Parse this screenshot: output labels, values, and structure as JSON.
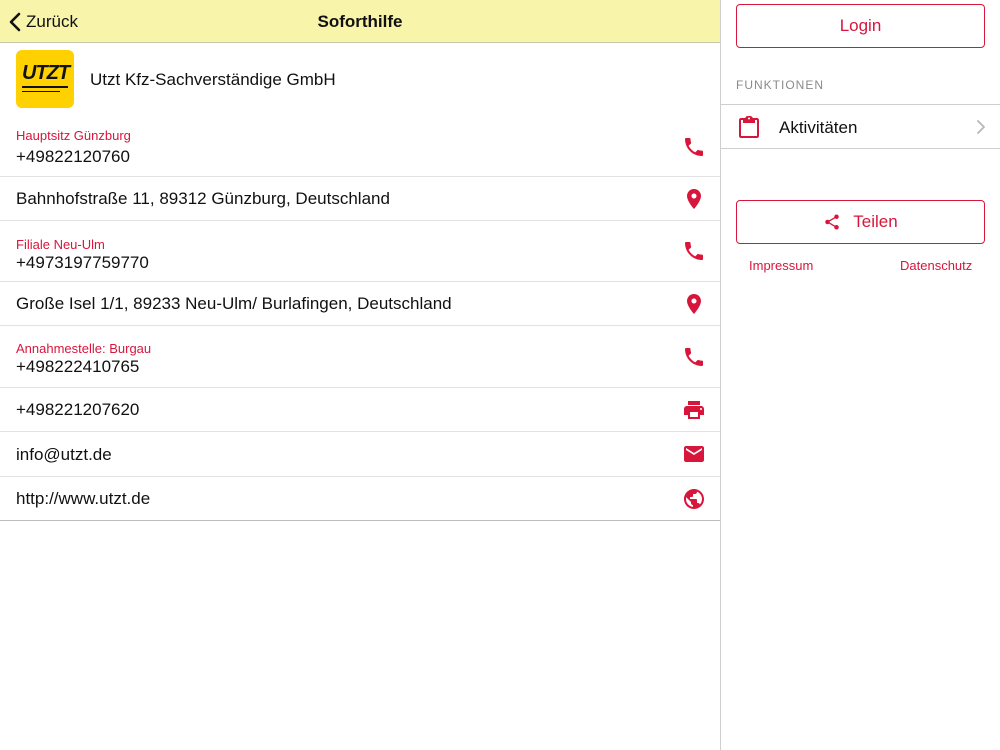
{
  "navbar": {
    "back_label": "Zurück",
    "title": "Soforthilfe"
  },
  "company": {
    "logo_text": "UTZT",
    "name": "Utzt Kfz-Sachverständige GmbH"
  },
  "contacts": {
    "hq_label": "Hauptsitz Günzburg",
    "hq_phone": "+49822120760",
    "hq_address": "Bahnhofstraße 11, 89312 Günzburg, Deutschland",
    "branch_label": "Filiale Neu-Ulm",
    "branch_phone": "+4973197759770",
    "branch_address": "Große Isel 1/1, 89233 Neu-Ulm/ Burlafingen, Deutschland",
    "intake_label": "Annahmestelle: Burgau",
    "intake_phone": "+498222410765",
    "fax": "+498221207620",
    "email": "info@utzt.de",
    "website": "http://www.utzt.de"
  },
  "sidebar": {
    "login_label": "Login",
    "section_header": "FUNKTIONEN",
    "activities_label": "Aktivitäten",
    "share_label": "Teilen",
    "imprint_label": "Impressum",
    "privacy_label": "Datenschutz"
  },
  "colors": {
    "accent": "#d8163c",
    "navbar_bg": "#f8f4a9",
    "logo_bg": "#ffd100"
  }
}
